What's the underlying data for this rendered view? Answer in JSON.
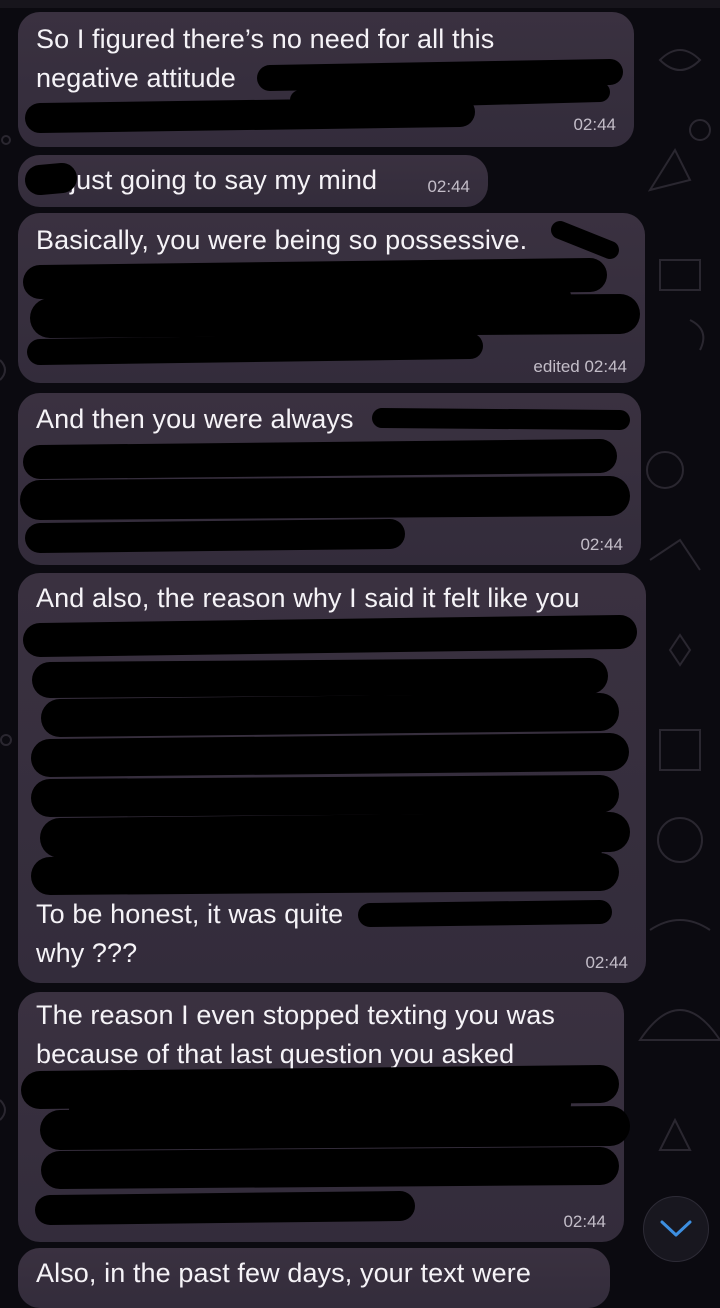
{
  "messages": [
    {
      "lines": [
        "So I figured there’s no need for all this",
        "negative attitude"
      ],
      "time": "02:44"
    },
    {
      "lines": [
        "just going to say my mind"
      ],
      "time": "02:44"
    },
    {
      "lines": [
        "Basically, you were being so possessive."
      ],
      "time": "edited 02:44"
    },
    {
      "lines": [
        "And then you were always"
      ],
      "time": "02:44"
    },
    {
      "lines": [
        "And also, the reason why I said it felt like you",
        "To be honest, it was quite",
        "why ???"
      ],
      "time": "02:44"
    },
    {
      "lines": [
        "The reason I even stopped texting you was",
        "because of that last question you asked"
      ],
      "time": "02:44"
    },
    {
      "lines": [
        "Also, in the past few days, your text were"
      ],
      "time": ""
    }
  ],
  "scroll_button": {
    "icon": "chevron-down-icon"
  }
}
